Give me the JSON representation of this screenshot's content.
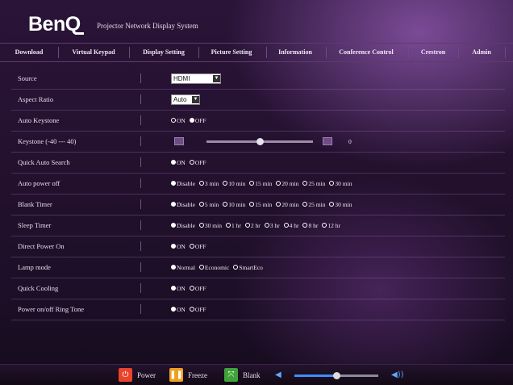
{
  "header": {
    "logo": "BenQ",
    "subtitle": "Projector Network Display System"
  },
  "nav": [
    {
      "label": "Download"
    },
    {
      "label": "Virtual Keypad"
    },
    {
      "label": "Display Setting"
    },
    {
      "label": "Picture Setting"
    },
    {
      "label": "Information"
    },
    {
      "label": "Conference Control"
    },
    {
      "label": "Crestron"
    },
    {
      "label": "Admin"
    }
  ],
  "settings": {
    "source": {
      "label": "Source",
      "value": "HDMI"
    },
    "aspect_ratio": {
      "label": "Aspect Ratio",
      "value": "Auto"
    },
    "auto_keystone": {
      "label": "Auto Keystone",
      "options": [
        "ON",
        "OFF"
      ],
      "selected": "OFF"
    },
    "keystone": {
      "label": "Keystone (-40 --- 40)",
      "value": "0",
      "min": -40,
      "max": 40
    },
    "quick_auto_search": {
      "label": "Quick Auto Search",
      "options": [
        "ON",
        "OFF"
      ],
      "selected": "ON"
    },
    "auto_power_off": {
      "label": "Auto power off",
      "options": [
        "Disable",
        "3 min",
        "10 min",
        "15 min",
        "20 min",
        "25 min",
        "30 min"
      ],
      "selected": "Disable"
    },
    "blank_timer": {
      "label": "Blank Timer",
      "options": [
        "Disable",
        "5 min",
        "10 min",
        "15 min",
        "20 min",
        "25 min",
        "30 min"
      ],
      "selected": "Disable"
    },
    "sleep_timer": {
      "label": "Sleep Timer",
      "options": [
        "Disable",
        "30 min",
        "1 hr",
        "2 hr",
        "3 hr",
        "4 hr",
        "8 hr",
        "12 hr"
      ],
      "selected": "Disable"
    },
    "direct_power_on": {
      "label": "Direct Power On",
      "options": [
        "ON",
        "OFF"
      ],
      "selected": "ON"
    },
    "lamp_mode": {
      "label": "Lamp mode",
      "options": [
        "Normal",
        "Economic",
        "SmartEco"
      ],
      "selected": "Normal"
    },
    "quick_cooling": {
      "label": "Quick Cooling",
      "options": [
        "ON",
        "OFF"
      ],
      "selected": "ON"
    },
    "power_ring_tone": {
      "label": "Power on/off Ring Tone",
      "options": [
        "ON",
        "OFF"
      ],
      "selected": "ON"
    }
  },
  "footer": {
    "power_label": "Power",
    "freeze_label": "Freeze",
    "blank_label": "Blank",
    "volume_level": 0.5
  },
  "colors": {
    "power_icon": "#e8442c",
    "freeze_icon": "#f0a020",
    "blank_icon": "#3fa33a",
    "volume_accent": "#3c8fff"
  },
  "icons": {
    "power": "power-icon",
    "freeze": "pause-icon",
    "blank": "blank-screen-icon",
    "volume_down": "speaker-low-icon",
    "volume_up": "speaker-high-icon"
  }
}
